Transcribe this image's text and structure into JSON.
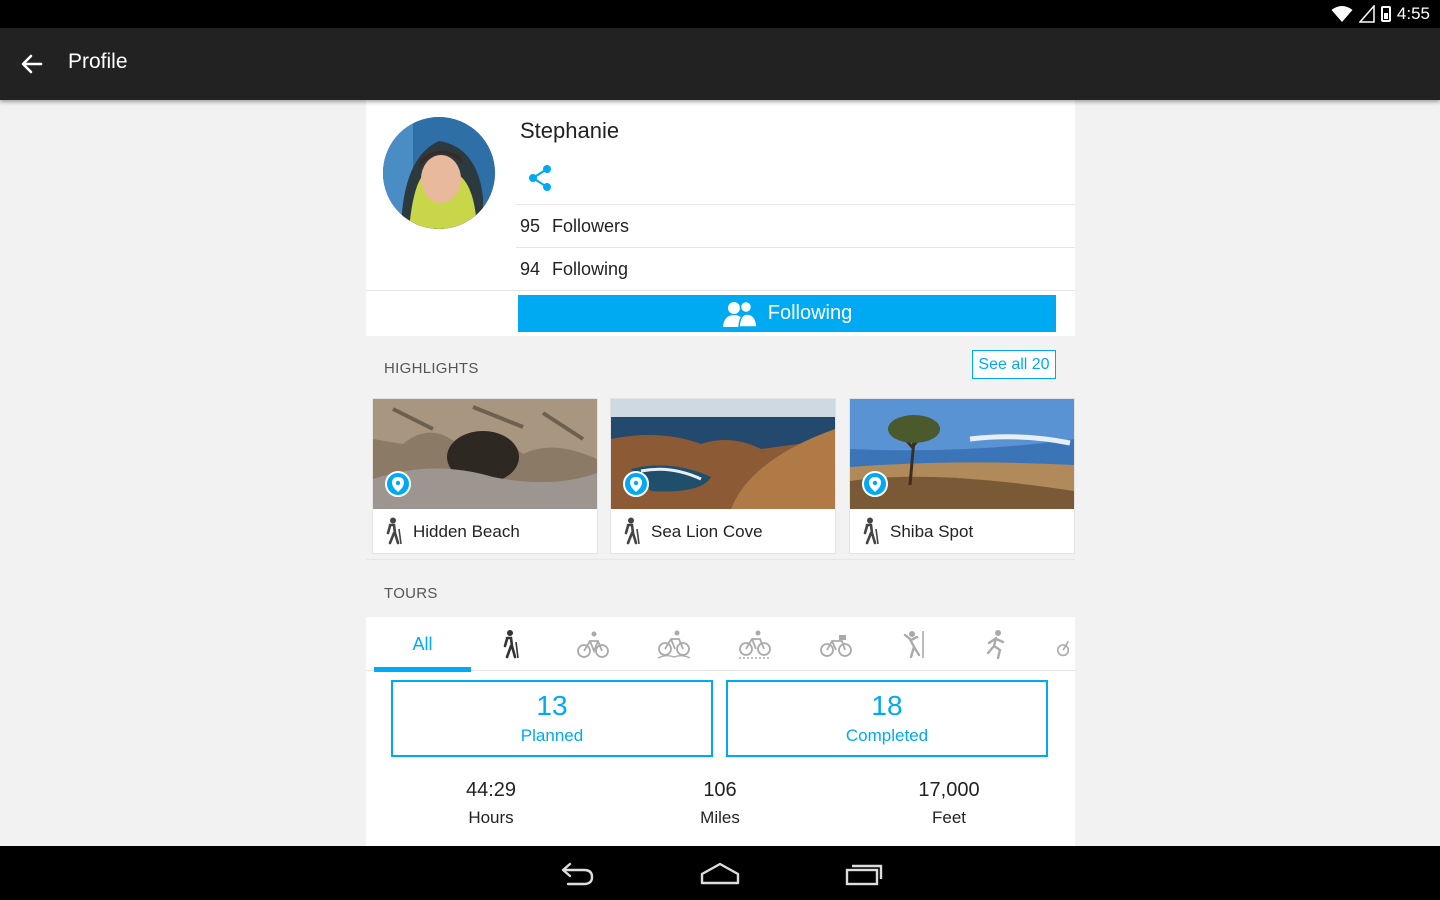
{
  "status_bar": {
    "time": "4:55",
    "icons": [
      "wifi-icon",
      "signal-icon",
      "battery-icon"
    ]
  },
  "app_bar": {
    "title": "Profile",
    "back_icon": "arrow-left-icon"
  },
  "profile": {
    "name": "Stephanie",
    "share_icon": "share-icon",
    "followers": {
      "count": "95",
      "label": "Followers"
    },
    "following": {
      "count": "94",
      "label": "Following"
    },
    "follow_button": {
      "label": "Following",
      "icon": "people-icon"
    }
  },
  "highlights": {
    "label": "HIGHLIGHTS",
    "see_all": "See all 20",
    "items": [
      {
        "name": "Hidden Beach",
        "icon": "hiking-icon"
      },
      {
        "name": "Sea Lion Cove",
        "icon": "hiking-icon"
      },
      {
        "name": "Shiba Spot",
        "icon": "hiking-icon"
      }
    ]
  },
  "tours": {
    "label": "TOURS",
    "tabs": [
      {
        "label": "All",
        "selected": true
      },
      {
        "icon": "hiking-icon"
      },
      {
        "icon": "bike-icon"
      },
      {
        "icon": "mountain-bike-icon"
      },
      {
        "icon": "road-bike-icon"
      },
      {
        "icon": "touring-bike-icon"
      },
      {
        "icon": "climbing-icon"
      },
      {
        "icon": "running-icon"
      }
    ],
    "planned": {
      "value": "13",
      "label": "Planned"
    },
    "completed": {
      "value": "18",
      "label": "Completed"
    },
    "metrics": [
      {
        "value": "44:29",
        "label": "Hours"
      },
      {
        "value": "106",
        "label": "Miles"
      },
      {
        "value": "17,000",
        "label": "Feet"
      }
    ]
  },
  "colors": {
    "accent": "#00aaf2",
    "app_bar": "#222222",
    "background": "#f2f2f2"
  },
  "nav_bar": {
    "icons": [
      "nav-back-icon",
      "nav-home-icon",
      "nav-recents-icon"
    ]
  }
}
